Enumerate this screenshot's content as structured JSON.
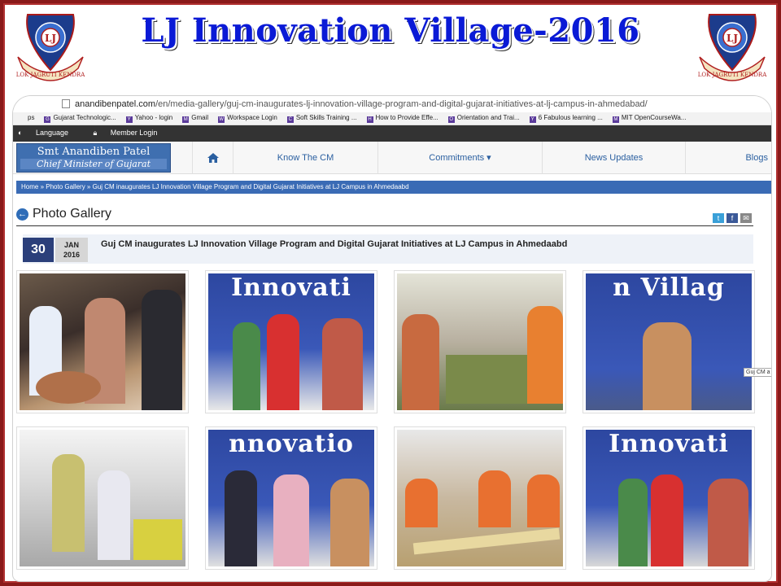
{
  "slide": {
    "title": "LJ Innovation Village-2016",
    "logo_text": "LOK JAGRUTI KENDRA",
    "logo_initials": "LJ"
  },
  "browser": {
    "url_host": "anandibenpatel.com",
    "url_path": "/en/media-gallery/guj-cm-inaugurates-lj-innovation-village-program-and-digital-gujarat-initiatives-at-lj-campus-in-ahmedabad/",
    "bookmarks": [
      {
        "label": "ps",
        "icon": ""
      },
      {
        "label": "Gujarat Technologic...",
        "icon": "G"
      },
      {
        "label": "Yahoo - login",
        "icon": "Y"
      },
      {
        "label": "Gmail",
        "icon": "M"
      },
      {
        "label": "Workspace Login",
        "icon": "W"
      },
      {
        "label": "Soft Skills Training ...",
        "icon": "C"
      },
      {
        "label": "How to Provide Effe...",
        "icon": "H"
      },
      {
        "label": "Orientation and Trai...",
        "icon": "O"
      },
      {
        "label": "6 Fabulous learning ...",
        "icon": "Y"
      },
      {
        "label": "MIT OpenCourseWa...",
        "icon": "M"
      }
    ]
  },
  "site": {
    "top_links": [
      "Language",
      "Member Login"
    ],
    "brand_name": "Smt Anandiben Patel",
    "brand_role": "Chief Minister of Gujarat",
    "nav": [
      "Know The CM",
      "Commitments ▾",
      "News Updates",
      "Blogs"
    ],
    "breadcrumb": "Home » Photo Gallery » Guj CM inaugurates LJ Innovation Village Program and Digital Gujarat Initiatives at LJ Campus in Ahmedaabd",
    "gallery_title": "Photo Gallery",
    "share_icons": [
      "twitter-icon",
      "facebook-icon",
      "email-icon"
    ]
  },
  "event": {
    "day": "30",
    "month": "JAN",
    "year": "2016",
    "title": "Guj CM inaugurates LJ Innovation Village Program and Digital Gujarat Initiatives at LJ Campus in Ahmedaabd"
  },
  "photos": [
    {
      "alt": "CM viewing clay pottery exhibit",
      "banner": ""
    },
    {
      "alt": "Students presenting certificate",
      "banner": "Innovati"
    },
    {
      "alt": "CM at project model table",
      "banner": ""
    },
    {
      "alt": "CM addressing audience",
      "banner": "n Villag"
    },
    {
      "alt": "Students with engineering model",
      "banner": ""
    },
    {
      "alt": "Award presentation on stage",
      "banner": "nnovatio"
    },
    {
      "alt": "Students in safety helmets with bridge model",
      "banner": ""
    },
    {
      "alt": "Group of students on stage",
      "banner": "Innovati"
    }
  ],
  "tooltip": "Guj CM a",
  "colors": {
    "title": "#0a1ad6",
    "brand": "#3f6fb0",
    "breadcrumb": "#3a6bb5",
    "date_day": "#2b3f7a"
  }
}
